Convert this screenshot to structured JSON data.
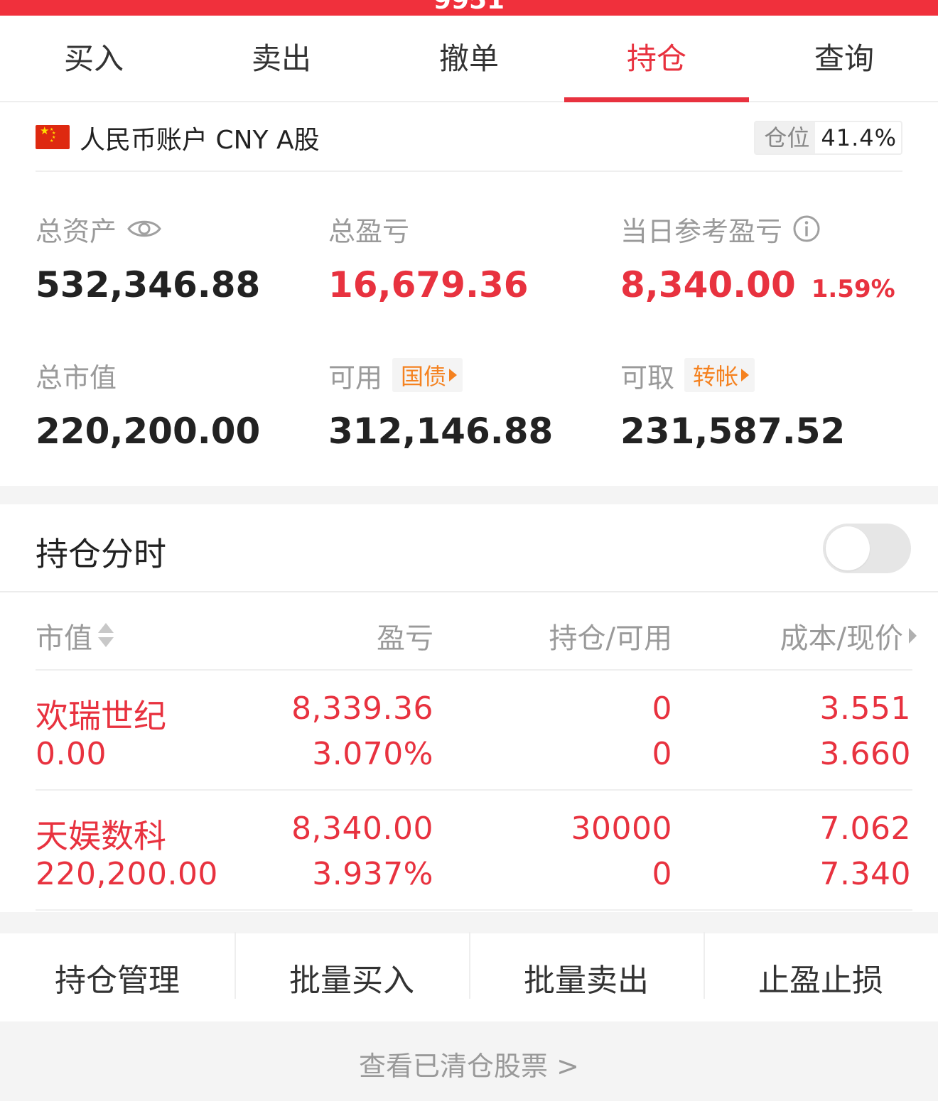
{
  "topbar": {
    "text": "9951"
  },
  "tabs": [
    {
      "label": "买入"
    },
    {
      "label": "卖出"
    },
    {
      "label": "撤单"
    },
    {
      "label": "持仓",
      "active": true
    },
    {
      "label": "查询"
    }
  ],
  "account": {
    "name": "人民币账户 CNY A股",
    "position_label": "仓位",
    "position_value": "41.4%"
  },
  "summary": {
    "total_assets_label": "总资产",
    "total_assets": "532,346.88",
    "total_pl_label": "总盈亏",
    "total_pl": "16,679.36",
    "daily_pl_label": "当日参考盈亏",
    "daily_pl": "8,340.00",
    "daily_pl_pct": "1.59%",
    "market_value_label": "总市值",
    "market_value": "220,200.00",
    "available_label": "可用",
    "available_tag": "国债",
    "available": "312,146.88",
    "withdrawable_label": "可取",
    "withdrawable_tag": "转帐",
    "withdrawable": "231,587.52"
  },
  "timing": {
    "title": "持仓分时",
    "enabled": false
  },
  "table": {
    "headers": {
      "market_value": "市值",
      "pl": "盈亏",
      "holding": "持仓/可用",
      "cost": "成本/现价"
    },
    "rows": [
      {
        "name": "欢瑞世纪",
        "market_value": "0.00",
        "pl": "8,339.36",
        "pl_pct": "3.070%",
        "holding": "0",
        "available": "0",
        "cost": "3.551",
        "price": "3.660"
      },
      {
        "name": "天娱数科",
        "market_value": "220,200.00",
        "pl": "8,340.00",
        "pl_pct": "3.937%",
        "holding": "30000",
        "available": "0",
        "cost": "7.062",
        "price": "7.340"
      }
    ]
  },
  "actions": [
    {
      "label": "持仓管理"
    },
    {
      "label": "批量买入"
    },
    {
      "label": "批量卖出"
    },
    {
      "label": "止盈止损"
    }
  ],
  "cleared_link": "查看已清仓股票 >",
  "colors": {
    "accent": "#e8323f",
    "tag_orange": "#f58220",
    "muted": "#9a9a9a"
  }
}
